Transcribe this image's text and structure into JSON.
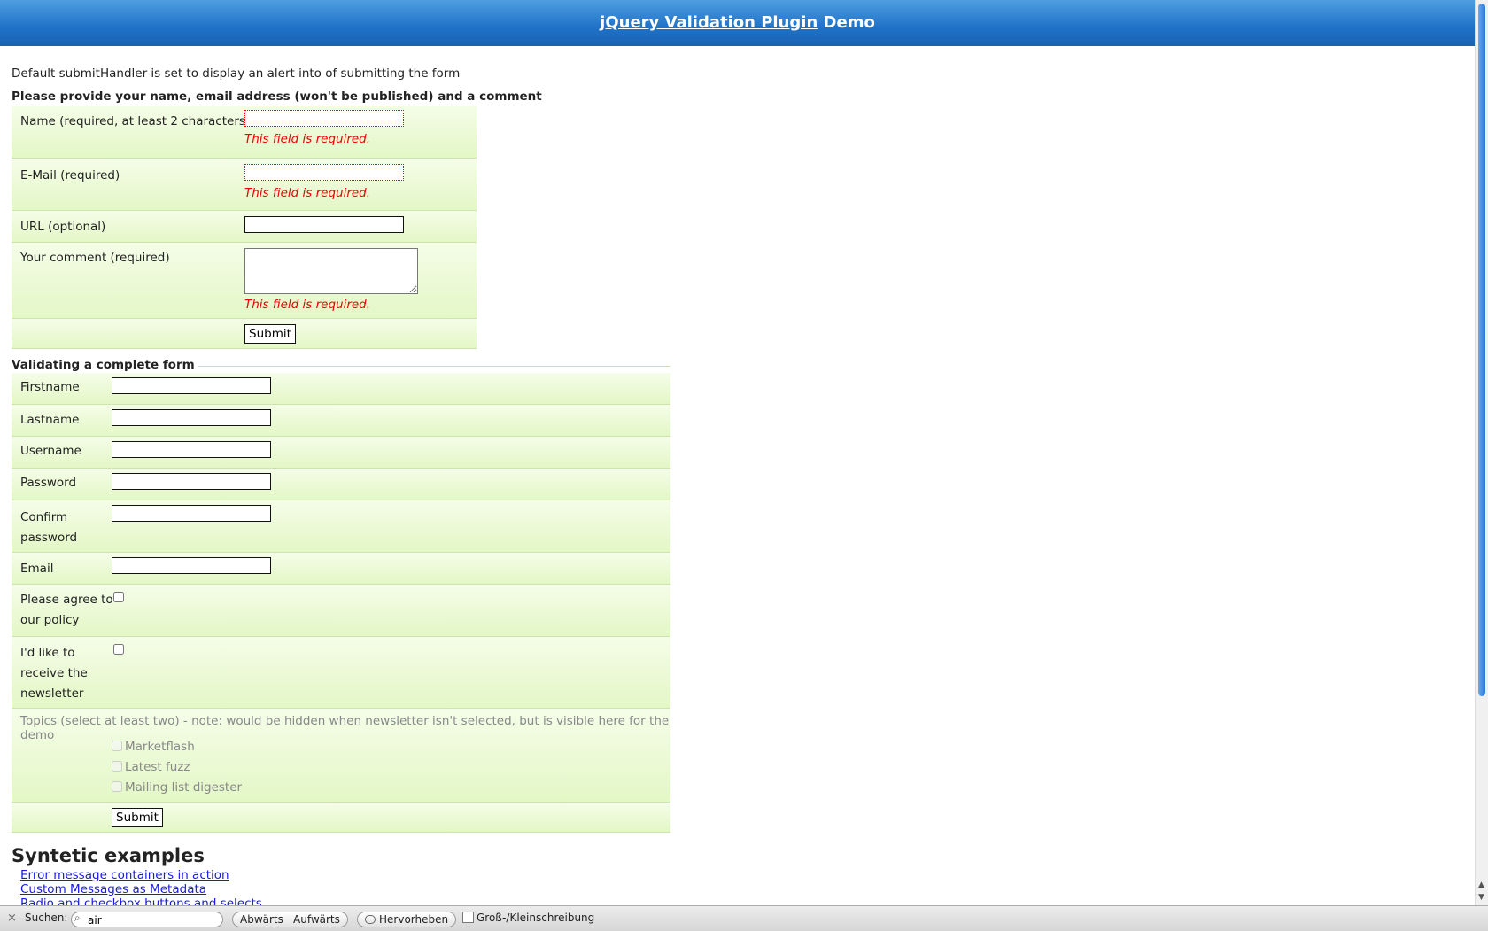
{
  "header": {
    "title_link": "jQuery Validation Plugin",
    "title_rest": "Demo"
  },
  "intro": "Default submitHandler is set to display an alert into of submitting the form",
  "form1": {
    "legend": "Please provide your name, email address (won't be published) and a comment",
    "name_label": "Name (required, at least 2 characters)",
    "email_label": "E-Mail (required)",
    "url_label": "URL (optional)",
    "comment_label": "Your comment (required)",
    "error": "This field is required.",
    "submit": "Submit"
  },
  "form2": {
    "legend": "Validating a complete form",
    "firstname": "Firstname",
    "lastname": "Lastname",
    "username": "Username",
    "password": "Password",
    "confirm_line1": "Confirm",
    "confirm_line2": "password",
    "email": "Email",
    "agree_line1": "Please agree to",
    "agree_line2": "our policy",
    "newsletter_line1": "I'd like to",
    "newsletter_line2": "receive the",
    "newsletter_line3": "newsletter",
    "topics_note": "Topics (select at least two) - note: would be hidden when newsletter isn't selected, but is visible here for the demo",
    "topics": [
      "Marketflash",
      "Latest fuzz",
      "Mailing list digester"
    ],
    "submit": "Submit"
  },
  "synthetic": {
    "heading": "Syntetic examples",
    "links": [
      "Error message containers in action",
      "Custom Messages as Metadata",
      "Radio and checkbox buttons and selects"
    ]
  },
  "findbar": {
    "close": "×",
    "label": "Suchen:",
    "query": "air",
    "down": "Abwärts",
    "up": "Aufwärts",
    "highlight": "Hervorheben",
    "matchcase": "Groß-/Kleinschreibung"
  },
  "scroll": {
    "up_arrow": "▲",
    "down_arrow": "▼"
  }
}
